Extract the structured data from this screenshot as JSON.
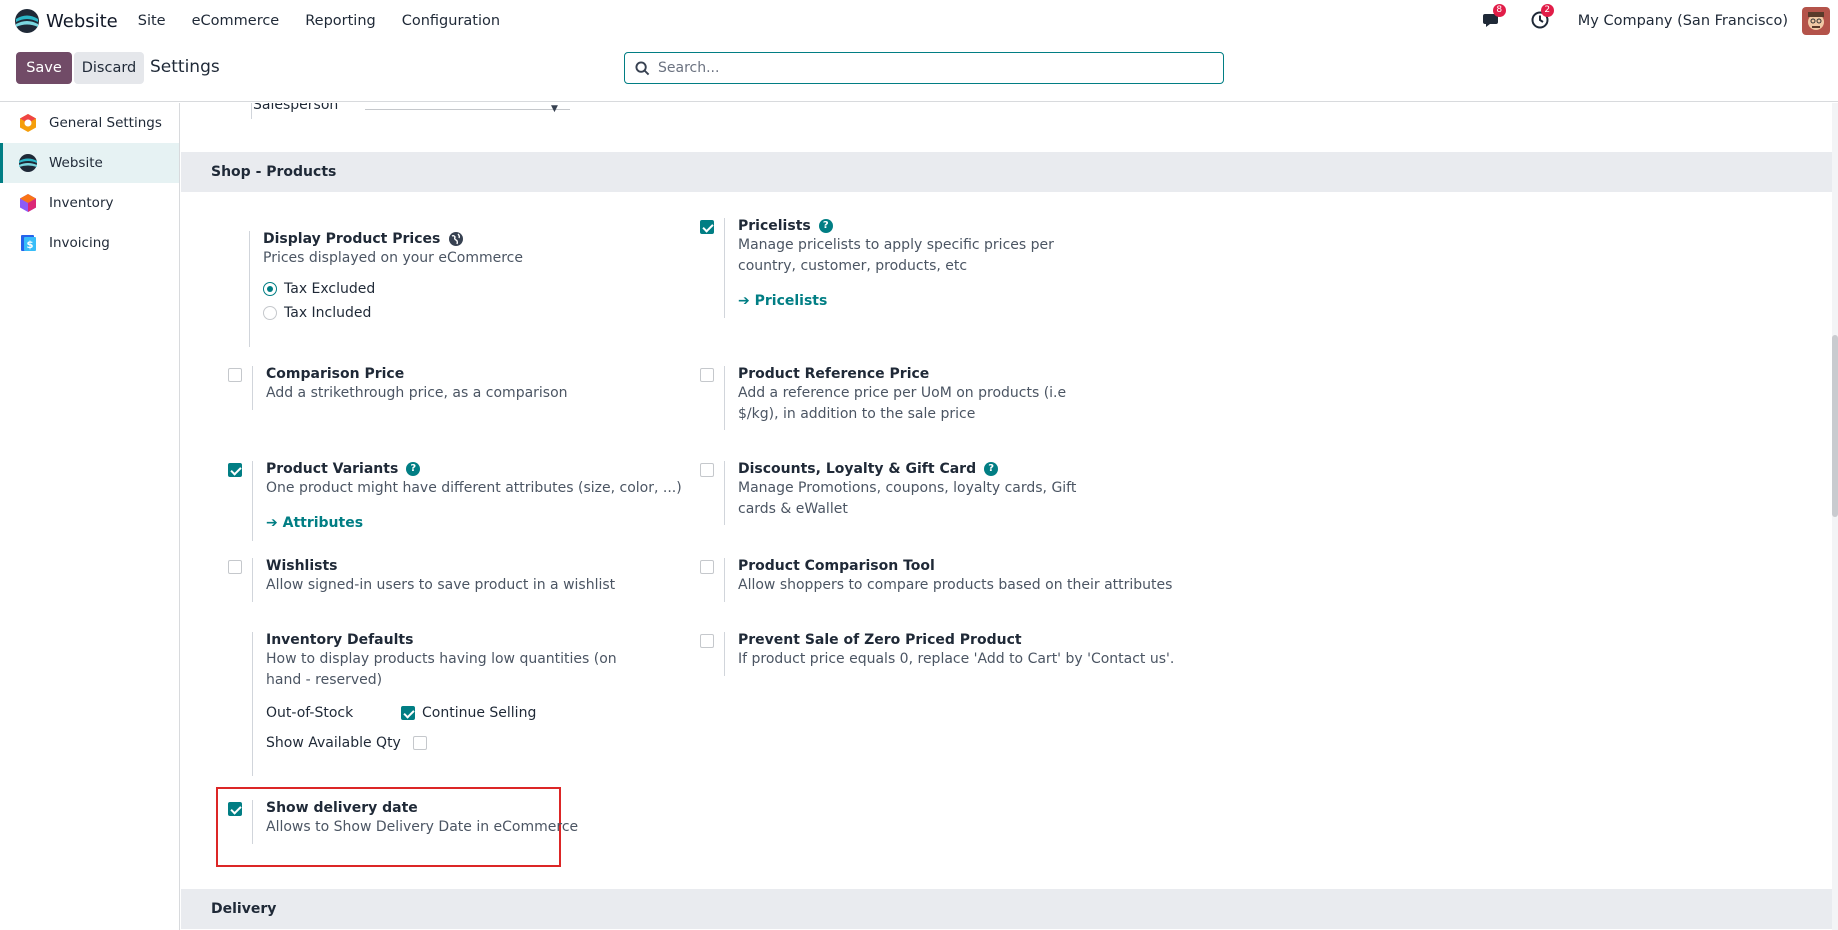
{
  "navbar": {
    "app_name": "Website",
    "menu": [
      "Site",
      "eCommerce",
      "Reporting",
      "Configuration"
    ],
    "messages_count": "8",
    "activities_count": "2",
    "company": "My Company (San Francisco)"
  },
  "control": {
    "save_label": "Save",
    "discard_label": "Discard",
    "title": "Settings",
    "search_placeholder": "Search..."
  },
  "sidebar": {
    "items": [
      {
        "label": "General Settings"
      },
      {
        "label": "Website"
      },
      {
        "label": "Inventory"
      },
      {
        "label": "Invoicing"
      }
    ]
  },
  "main": {
    "cut_label": "Salesperson",
    "section_shop": "Shop - Products",
    "section_delivery": "Delivery",
    "display_prices": {
      "title": "Display Product Prices",
      "desc": "Prices displayed on your eCommerce",
      "options": [
        "Tax Excluded",
        "Tax Included"
      ],
      "selected": "Tax Excluded"
    },
    "pricelists": {
      "title": "Pricelists",
      "desc": "Manage pricelists to apply specific prices per country, customer, products, etc",
      "link": "Pricelists",
      "checked": true
    },
    "comparison_price": {
      "title": "Comparison Price",
      "desc": "Add a strikethrough price, as a comparison",
      "checked": false
    },
    "reference_price": {
      "title": "Product Reference Price",
      "desc": "Add a reference price per UoM on products (i.e $/kg), in addition to the sale price",
      "checked": false
    },
    "variants": {
      "title": "Product Variants",
      "desc": "One product might have different attributes (size, color, ...)",
      "link": "Attributes",
      "checked": true
    },
    "discounts": {
      "title": "Discounts, Loyalty & Gift Card",
      "desc": "Manage Promotions, coupons, loyalty cards, Gift cards & eWallet",
      "checked": false
    },
    "wishlists": {
      "title": "Wishlists",
      "desc": "Allow signed-in users to save product in a wishlist",
      "checked": false
    },
    "comparison_tool": {
      "title": "Product Comparison Tool",
      "desc": "Allow shoppers to compare products based on their attributes",
      "checked": false
    },
    "inventory_defaults": {
      "title": "Inventory Defaults",
      "desc": "How to display products having low quantities (on hand - reserved)",
      "out_of_stock_label": "Out-of-Stock",
      "continue_selling_label": "Continue Selling",
      "continue_selling_checked": true,
      "show_qty_label": "Show Available Qty",
      "show_qty_checked": false
    },
    "zero_price": {
      "title": "Prevent Sale of Zero Priced Product",
      "desc": "If product price equals 0, replace 'Add to Cart' by 'Contact us'.",
      "checked": false
    },
    "delivery_date": {
      "title": "Show delivery date",
      "desc": "Allows to Show Delivery Date in eCommerce",
      "checked": true
    }
  },
  "colors": {
    "primary": "#714b67",
    "accent": "#017e84",
    "highlight": "#dc2626",
    "badge": "#e11d48"
  }
}
